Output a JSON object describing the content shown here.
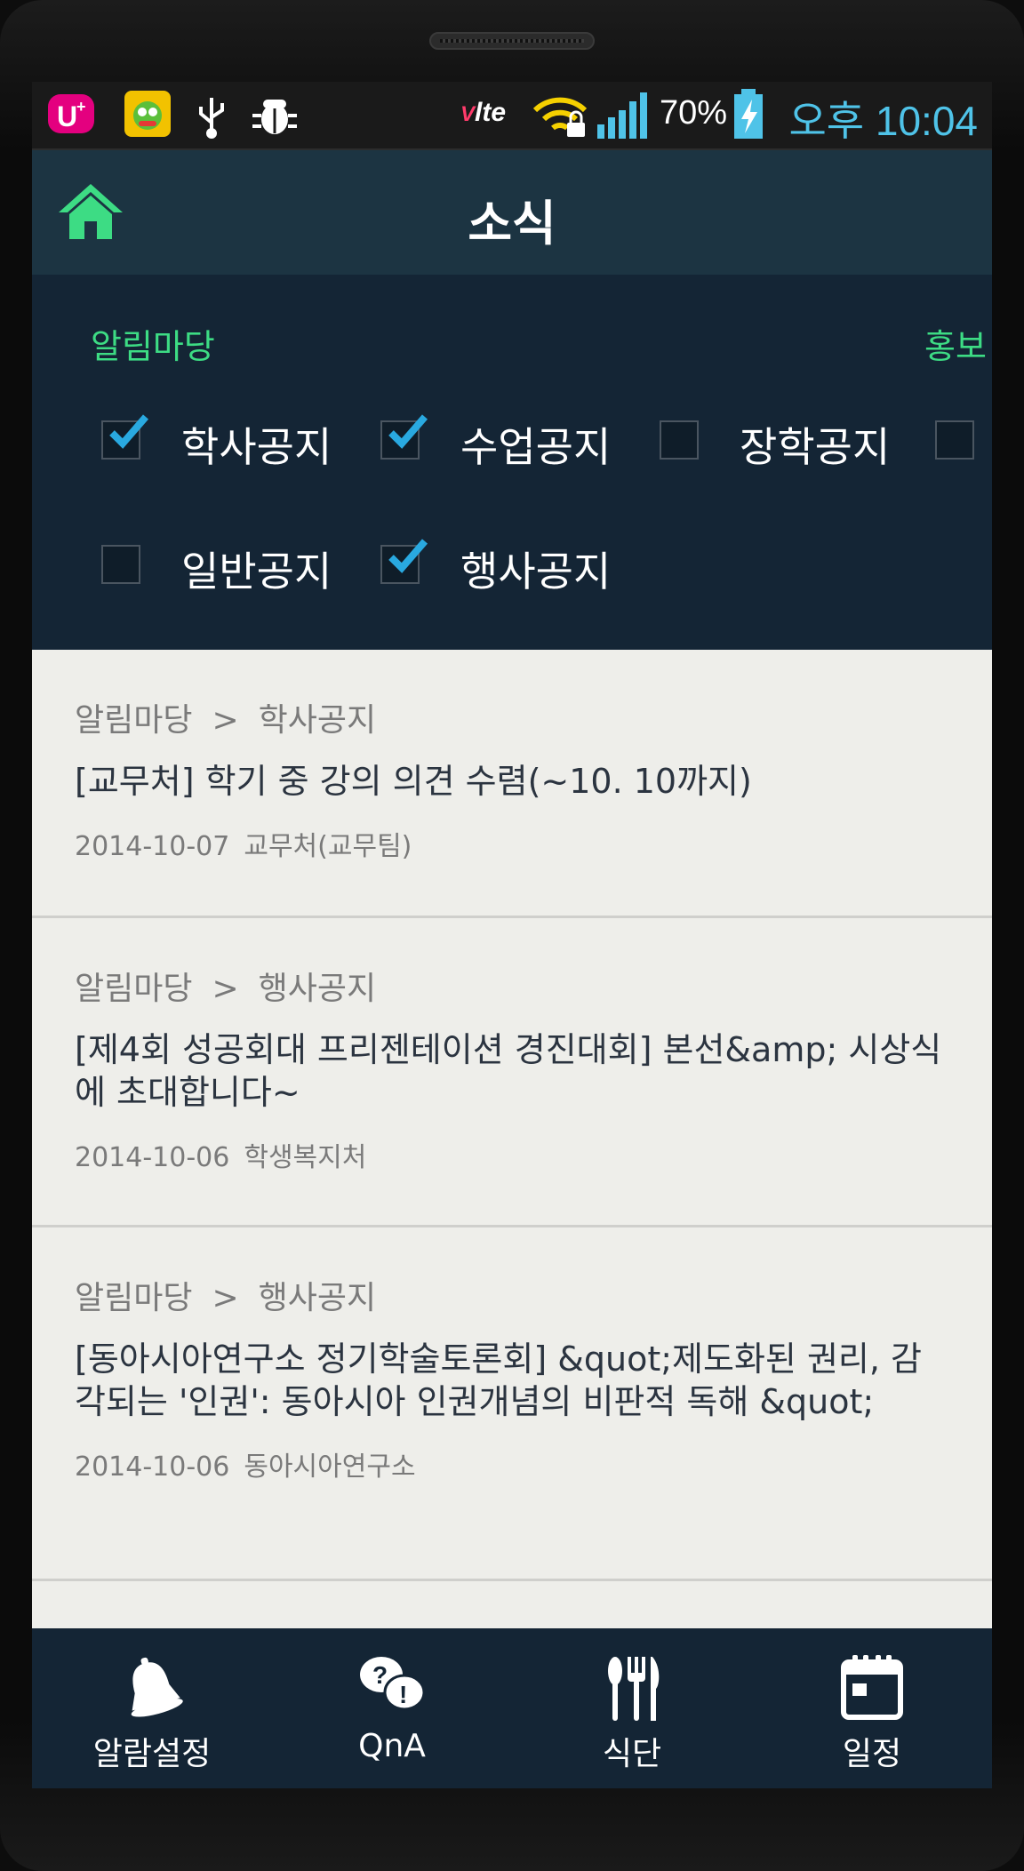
{
  "status_bar": {
    "network": "lte",
    "battery": "70%",
    "time": "오후 10:04",
    "icons": [
      "uplus-icon",
      "game-app-icon",
      "usb-icon",
      "bug-icon",
      "wifi-lock-icon",
      "signal-icon",
      "battery-charging-icon"
    ]
  },
  "header": {
    "title": "소식",
    "home_icon": "home-icon"
  },
  "filters": {
    "categories": [
      "알림마당",
      "홍보"
    ],
    "options": [
      {
        "label": "학사공지",
        "checked": true
      },
      {
        "label": "수업공지",
        "checked": true
      },
      {
        "label": "장학공지",
        "checked": false
      },
      {
        "label": "",
        "checked": false
      },
      {
        "label": "일반공지",
        "checked": false
      },
      {
        "label": "행사공지",
        "checked": true
      }
    ]
  },
  "list": {
    "separator": ">",
    "items": [
      {
        "category": "알림마당",
        "subcategory": "학사공지",
        "title": "[교무처] 학기 중 강의 의견 수렴(~10. 10까지)",
        "date": "2014-10-07",
        "source": "교무처(교무팀)"
      },
      {
        "category": "알림마당",
        "subcategory": "행사공지",
        "title": "[제4회 성공회대 프리젠테이션 경진대회] 본선&amp; 시상식에 초대합니다~",
        "date": "2014-10-06",
        "source": "학생복지처"
      },
      {
        "category": "알림마당",
        "subcategory": "행사공지",
        "title": "[동아시아연구소 정기학술토론회] &quot;제도화된 권리, 감각되는 '인권': 동아시아 인권개념의 비판적 독해 &quot;",
        "date": "2014-10-06",
        "source": "동아시아연구소"
      }
    ]
  },
  "bottom_nav": [
    {
      "label": "알람설정",
      "icon": "bell-icon"
    },
    {
      "label": "QnA",
      "icon": "qna-icon"
    },
    {
      "label": "식단",
      "icon": "utensils-icon"
    },
    {
      "label": "일정",
      "icon": "calendar-icon"
    }
  ],
  "colors": {
    "accent": "#3ddc84",
    "header": "#1c3442",
    "panel": "#142535",
    "time": "#4fc3e8",
    "check": "#29a9e0"
  }
}
